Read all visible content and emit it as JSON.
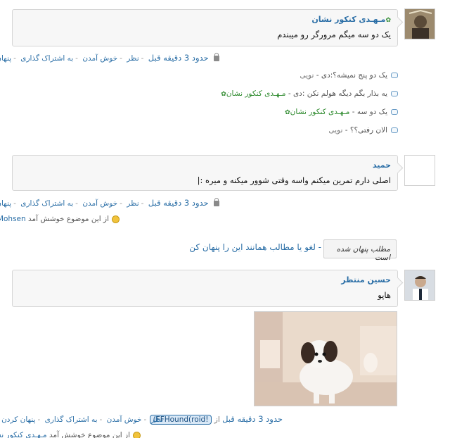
{
  "post1": {
    "author": "مـهـدی کنکور نشان",
    "text": "یک دو سه میگم مرورگر رو میبندم",
    "time": "حدود 3 دقیقه قبل",
    "actions": [
      "نظر",
      "خوش آمدن",
      "به اشتراک گذاری",
      "پنهان کردن"
    ],
    "replies": [
      {
        "text": "یک دو پنج نمیشه؟:دی",
        "name": "نویی",
        "star": false
      },
      {
        "text": "یه بذار بگم دیگه هولم نکن :دی",
        "name": "مـهـدی کنکور نشان",
        "star": true
      },
      {
        "text": "یک دو سه",
        "name": "مـهـدی کنکور نشان",
        "star": true
      },
      {
        "text": "الان رفتی؟؟",
        "name": "نویی",
        "star": false
      }
    ]
  },
  "post2": {
    "author": "حمید",
    "text": "اصلی دارم تمرین میکنم واسه وقتی شوور میکنه و میره :|",
    "time": "حدود 3 دقیقه قبل",
    "actions": [
      "نظر",
      "خوش آمدن",
      "به اشتراک گذاری",
      "پنهان کردن"
    ],
    "likes_user": "Mohsen",
    "likes_text": "از این موضوع خوشش آمد"
  },
  "hidden": {
    "box_label": "مطلب پنهان شده است",
    "text": "- لغو یا مطالب همانند این را پنهان کن"
  },
  "post3": {
    "author": "حسین منتظر",
    "text": "هاپو",
    "time": "حدود 3 دقیقه قبل",
    "via_prefix": "از",
    "via_tag": "(FFHound(roid!",
    "actions": [
      "نظر",
      "خوش آمدن",
      "به اشتراک گذاری",
      "پنهان کردن"
    ],
    "likes_user": "مـهـدی کنکور نشان",
    "likes_text": "از این موضوع خوشش آمد"
  },
  "colors": {
    "link": "#2a6ea6",
    "green_name": "#2e8a2e",
    "bubble_bg": "#f7f7f7"
  },
  "icons": [
    "comment-icon",
    "lock-icon",
    "smile-icon",
    "star-icon"
  ]
}
